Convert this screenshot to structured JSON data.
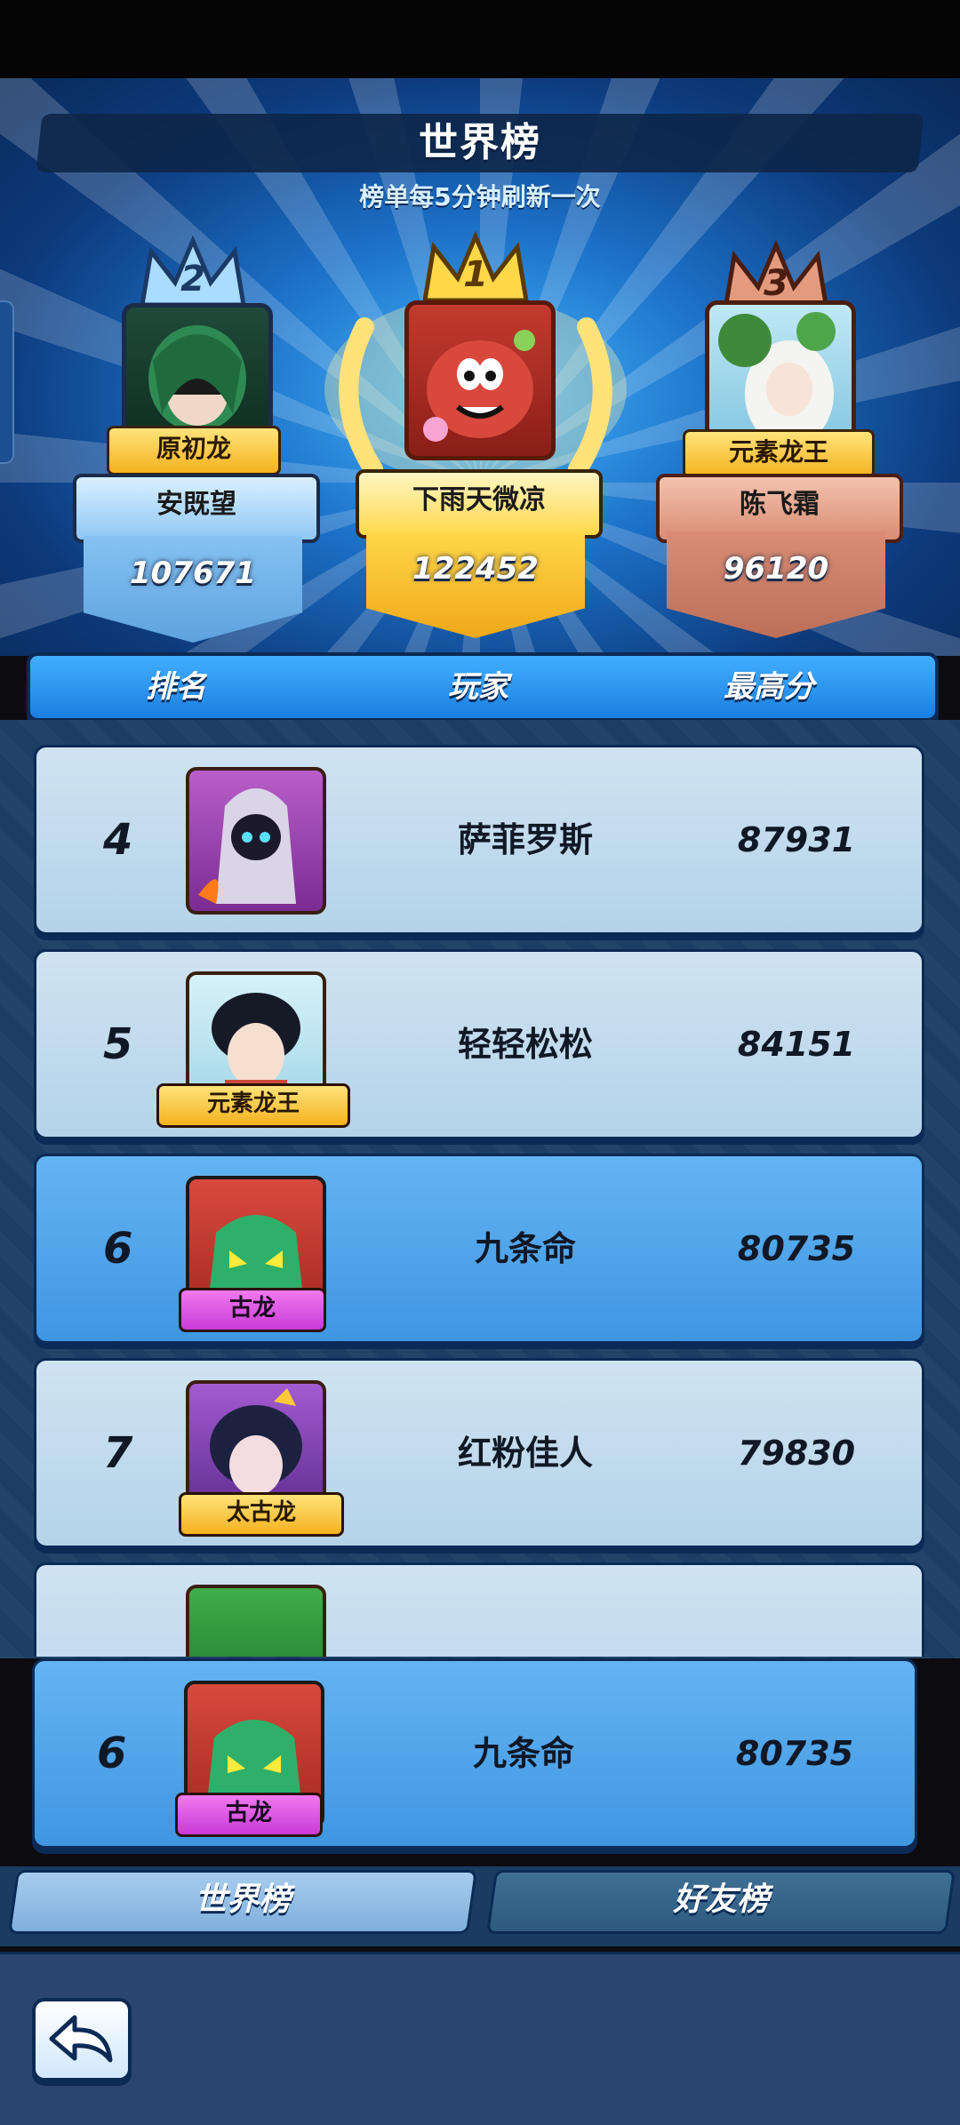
{
  "header": {
    "title": "世界榜",
    "subtitle": "榜单每5分钟刷新一次"
  },
  "podium": [
    {
      "rank": "2",
      "title": "原初龙",
      "name": "安既望",
      "score": "107671"
    },
    {
      "rank": "1",
      "title": "",
      "name": "下雨天微凉",
      "score": "122452"
    },
    {
      "rank": "3",
      "title": "元素龙王",
      "name": "陈飞霜",
      "score": "96120"
    }
  ],
  "table_header": {
    "rank": "排名",
    "player": "玩家",
    "score": "最高分"
  },
  "rows": [
    {
      "rank": "4",
      "name": "萨菲罗斯",
      "score": "87931",
      "title": ""
    },
    {
      "rank": "5",
      "name": "轻轻松松",
      "score": "84151",
      "title": "元素龙王"
    },
    {
      "rank": "6",
      "name": "九条命",
      "score": "80735",
      "title": "古龙"
    },
    {
      "rank": "7",
      "name": "红粉佳人",
      "score": "79830",
      "title": "太古龙"
    }
  ],
  "my_row": {
    "rank": "6",
    "name": "九条命",
    "score": "80735",
    "title": "古龙"
  },
  "tabs": {
    "world": "世界榜",
    "friends": "好友榜"
  },
  "icons": {
    "back": "back-arrow-icon",
    "crown": "crown-icon",
    "sparkle": "sparkle-icon"
  },
  "colors": {
    "gold": "#f4b21f",
    "silver": "#8fc7f6",
    "bronze": "#d98d74",
    "list_light": "#b4d3e9",
    "list_highlight": "#3f96e2"
  }
}
